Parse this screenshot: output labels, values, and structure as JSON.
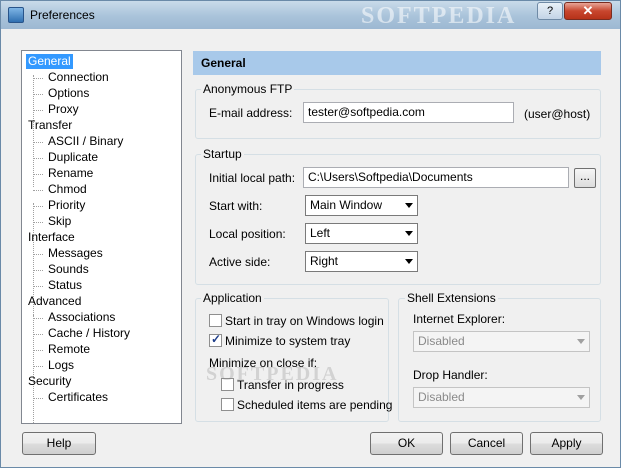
{
  "window": {
    "title": "Preferences",
    "watermark": "SOFTPEDIA",
    "help_glyph": "?",
    "close_glyph": "✕"
  },
  "tree": {
    "items": [
      {
        "label": "General",
        "level": 0,
        "selected": true
      },
      {
        "label": "Connection",
        "level": 1
      },
      {
        "label": "Options",
        "level": 1
      },
      {
        "label": "Proxy",
        "level": 1
      },
      {
        "label": "Transfer",
        "level": 0
      },
      {
        "label": "ASCII / Binary",
        "level": 1
      },
      {
        "label": "Duplicate",
        "level": 1
      },
      {
        "label": "Rename",
        "level": 1
      },
      {
        "label": "Chmod",
        "level": 1
      },
      {
        "label": "Priority",
        "level": 1
      },
      {
        "label": "Skip",
        "level": 1
      },
      {
        "label": "Interface",
        "level": 0
      },
      {
        "label": "Messages",
        "level": 1
      },
      {
        "label": "Sounds",
        "level": 1
      },
      {
        "label": "Status",
        "level": 1
      },
      {
        "label": "Advanced",
        "level": 0
      },
      {
        "label": "Associations",
        "level": 1
      },
      {
        "label": "Cache / History",
        "level": 1
      },
      {
        "label": "Remote",
        "level": 1
      },
      {
        "label": "Logs",
        "level": 1
      },
      {
        "label": "Security",
        "level": 0
      },
      {
        "label": "Certificates",
        "level": 1
      }
    ]
  },
  "panel": {
    "header": "General",
    "anon_ftp": {
      "title": "Anonymous FTP",
      "email_label": "E-mail address:",
      "email_value": "tester@softpedia.com",
      "email_hint": "(user@host)"
    },
    "startup": {
      "title": "Startup",
      "local_path_label": "Initial local path:",
      "local_path_value": "C:\\Users\\Softpedia\\Documents",
      "browse_label": "...",
      "start_with_label": "Start with:",
      "start_with_value": "Main Window",
      "local_pos_label": "Local position:",
      "local_pos_value": "Left",
      "active_side_label": "Active side:",
      "active_side_value": "Right"
    },
    "application": {
      "title": "Application",
      "tray_login": {
        "label": "Start in tray on Windows login",
        "checked": false
      },
      "minimize_tray": {
        "label": "Minimize to system tray",
        "checked": true
      },
      "minimize_close_label": "Minimize on close if:",
      "transfer_progress": {
        "label": "Transfer in progress",
        "checked": false
      },
      "scheduled_pending": {
        "label": "Scheduled items are pending",
        "checked": false
      }
    },
    "shell": {
      "title": "Shell Extensions",
      "ie_label": "Internet Explorer:",
      "ie_value": "Disabled",
      "drop_label": "Drop Handler:",
      "drop_value": "Disabled"
    }
  },
  "buttons": {
    "help": "Help",
    "ok": "OK",
    "cancel": "Cancel",
    "apply": "Apply"
  }
}
